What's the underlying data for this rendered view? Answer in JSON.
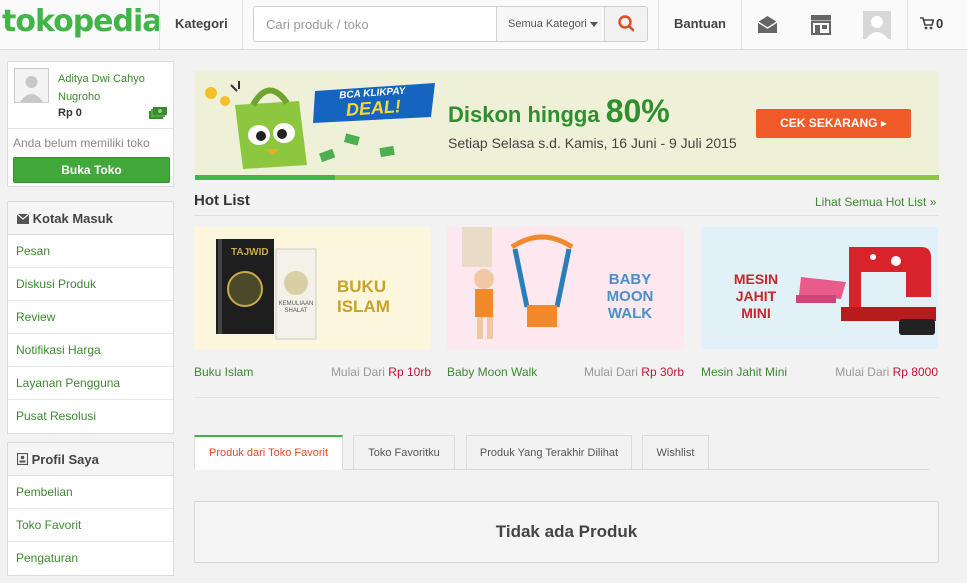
{
  "header": {
    "logo": "tokopedia",
    "kategori_label": "Kategori",
    "search_placeholder": "Cari produk / toko",
    "category_select": "Semua Kategori",
    "bantuan_label": "Bantuan",
    "cart_count": "0",
    "icons": [
      "search-icon",
      "mail-icon",
      "shop-icon",
      "avatar-icon",
      "cart-icon"
    ]
  },
  "user": {
    "name": "Aditya Dwi Cahyo Nugroho",
    "saldo": "Rp 0",
    "no_shop_text": "Anda belum memiliki toko",
    "open_shop_button": "Buka Toko"
  },
  "inbox": {
    "title": "Kotak Masuk",
    "items": [
      "Pesan",
      "Diskusi Produk",
      "Review",
      "Notifikasi Harga",
      "Layanan Pengguna",
      "Pusat Resolusi"
    ]
  },
  "profile": {
    "title": "Profil Saya",
    "items": [
      "Pembelian",
      "Toko Favorit",
      "Pengaturan"
    ]
  },
  "banner": {
    "badge_top": "BCA KLIKPAY",
    "badge_bottom": "DEAL!",
    "title_prefix": "Diskon hingga ",
    "title_big": "80%",
    "subtitle": "Setiap Selasa s.d. Kamis, 16 Juni - 9 Juli 2015",
    "cta": "CEK SEKARANG ▸"
  },
  "hotlist": {
    "title": "Hot List",
    "see_all": "Lihat Semua Hot List »",
    "price_prefix": "Mulai Dari",
    "items": [
      {
        "name": "Buku Islam",
        "price": "Rp 10rb",
        "image_text": "BUKU ISLAM",
        "book1": "TAJWID",
        "book2": "KEMULIAAN SHALAT"
      },
      {
        "name": "Baby Moon Walk",
        "price": "Rp 30rb",
        "image_text_1": "BABY",
        "image_text_2": "MOON WALK"
      },
      {
        "name": "Mesin Jahit Mini",
        "price": "Rp 8000",
        "image_text_1": "MESIN JAHIT",
        "image_text_2": "MINI"
      }
    ]
  },
  "tabs": {
    "items": [
      "Produk dari Toko Favorit",
      "Toko Favoritku",
      "Produk Yang Terakhir Dilihat",
      "Wishlist"
    ],
    "active": 0
  },
  "empty_message": "Tidak ada Produk",
  "colors": {
    "brand_green": "#42b549",
    "link_green": "#3c8a2f",
    "cta_orange": "#f05a28",
    "price_red": "#c8102e"
  }
}
